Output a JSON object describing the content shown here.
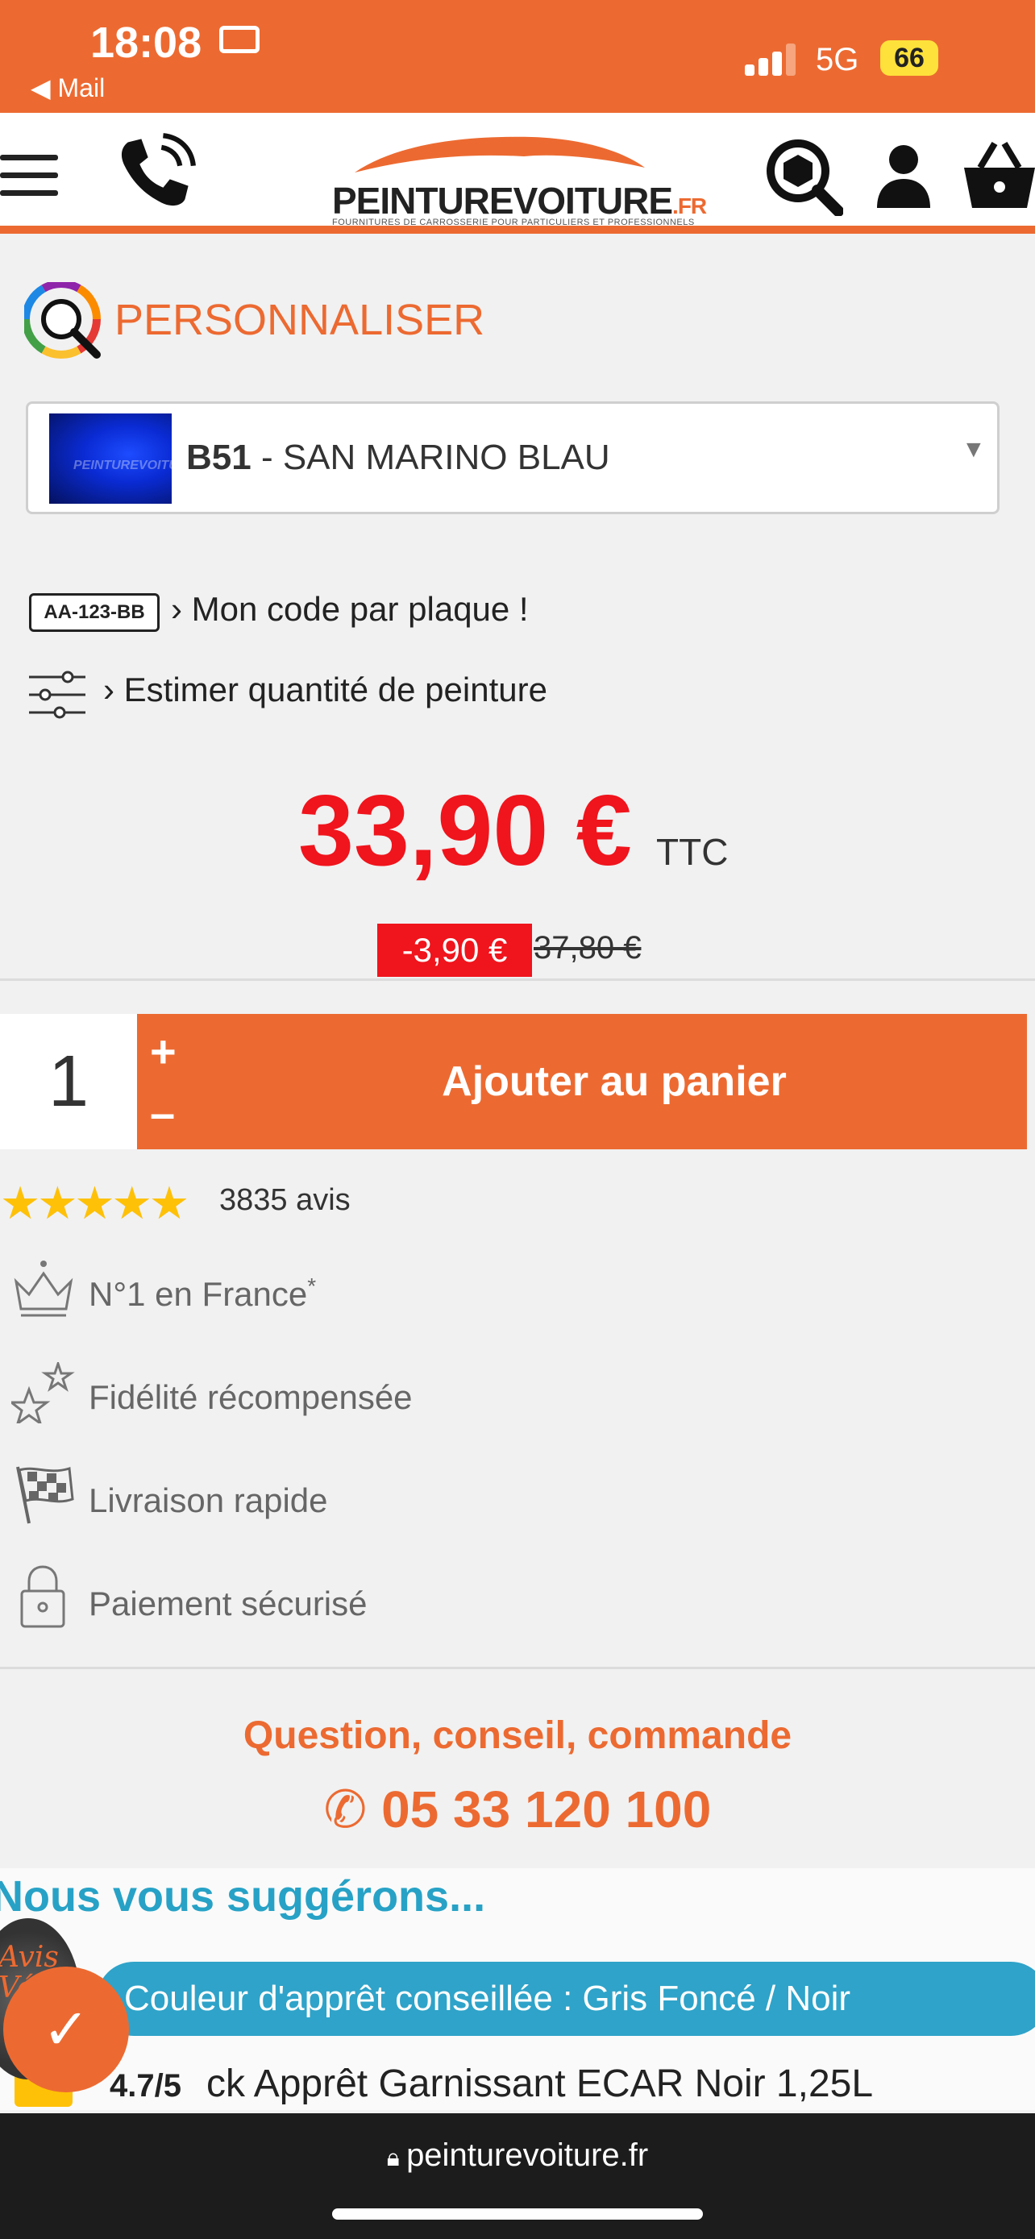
{
  "status": {
    "time": "18:08",
    "back_app": "◀ Mail",
    "network": "5G",
    "battery": "66"
  },
  "header": {
    "logo_main": "PEINTUREVOITURE",
    "logo_tld": ".FR",
    "logo_sub": "FOURNITURES DE CARROSSERIE POUR PARTICULIERS ET PROFESSIONNELS"
  },
  "personalize": {
    "title": "PERSONNALISER",
    "color_code": "B51",
    "color_name": " - SAN MARINO BLAU",
    "swatch_text": "PEINTUREVOITURE.fr"
  },
  "links": {
    "plate_badge": "AA-123-BB",
    "plate_label": "Mon code par plaque !",
    "estimate_label": "Estimer quantité de peinture"
  },
  "price": {
    "current": "33,90 €",
    "ttc": "TTC",
    "discount": "-3,90 €",
    "old": "37,80 €"
  },
  "cart": {
    "quantity": "1",
    "plus": "+",
    "minus": "–",
    "add_label": "Ajouter au panier"
  },
  "reviews": {
    "stars": "★★★★★",
    "rating_fraction": 0.9,
    "count": "3835 avis"
  },
  "features": [
    {
      "label": "N°1 en France",
      "sup": "*"
    },
    {
      "label": "Fidélité récompensée"
    },
    {
      "label": "Livraison rapide"
    },
    {
      "label": "Paiement sécurisé"
    }
  ],
  "contact": {
    "question": "Question, conseil, commande",
    "phone": "05 33 120 100"
  },
  "suggestions": {
    "title": "Nous vous suggérons...",
    "primer": "Couleur d'apprêt conseillée : Gris Foncé / Noir",
    "rating": "4.7/5",
    "product": "ck Apprêt Garnissant ECAR Noir 1,25L",
    "badge_text": "Avis Vérifiés"
  },
  "browser": {
    "url": "peinturevoiture.fr"
  },
  "colors": {
    "brand_orange": "#ec6a31",
    "price_red": "#f0141c",
    "suggest_blue": "#27a2c6",
    "star_yellow": "#ffc107"
  }
}
